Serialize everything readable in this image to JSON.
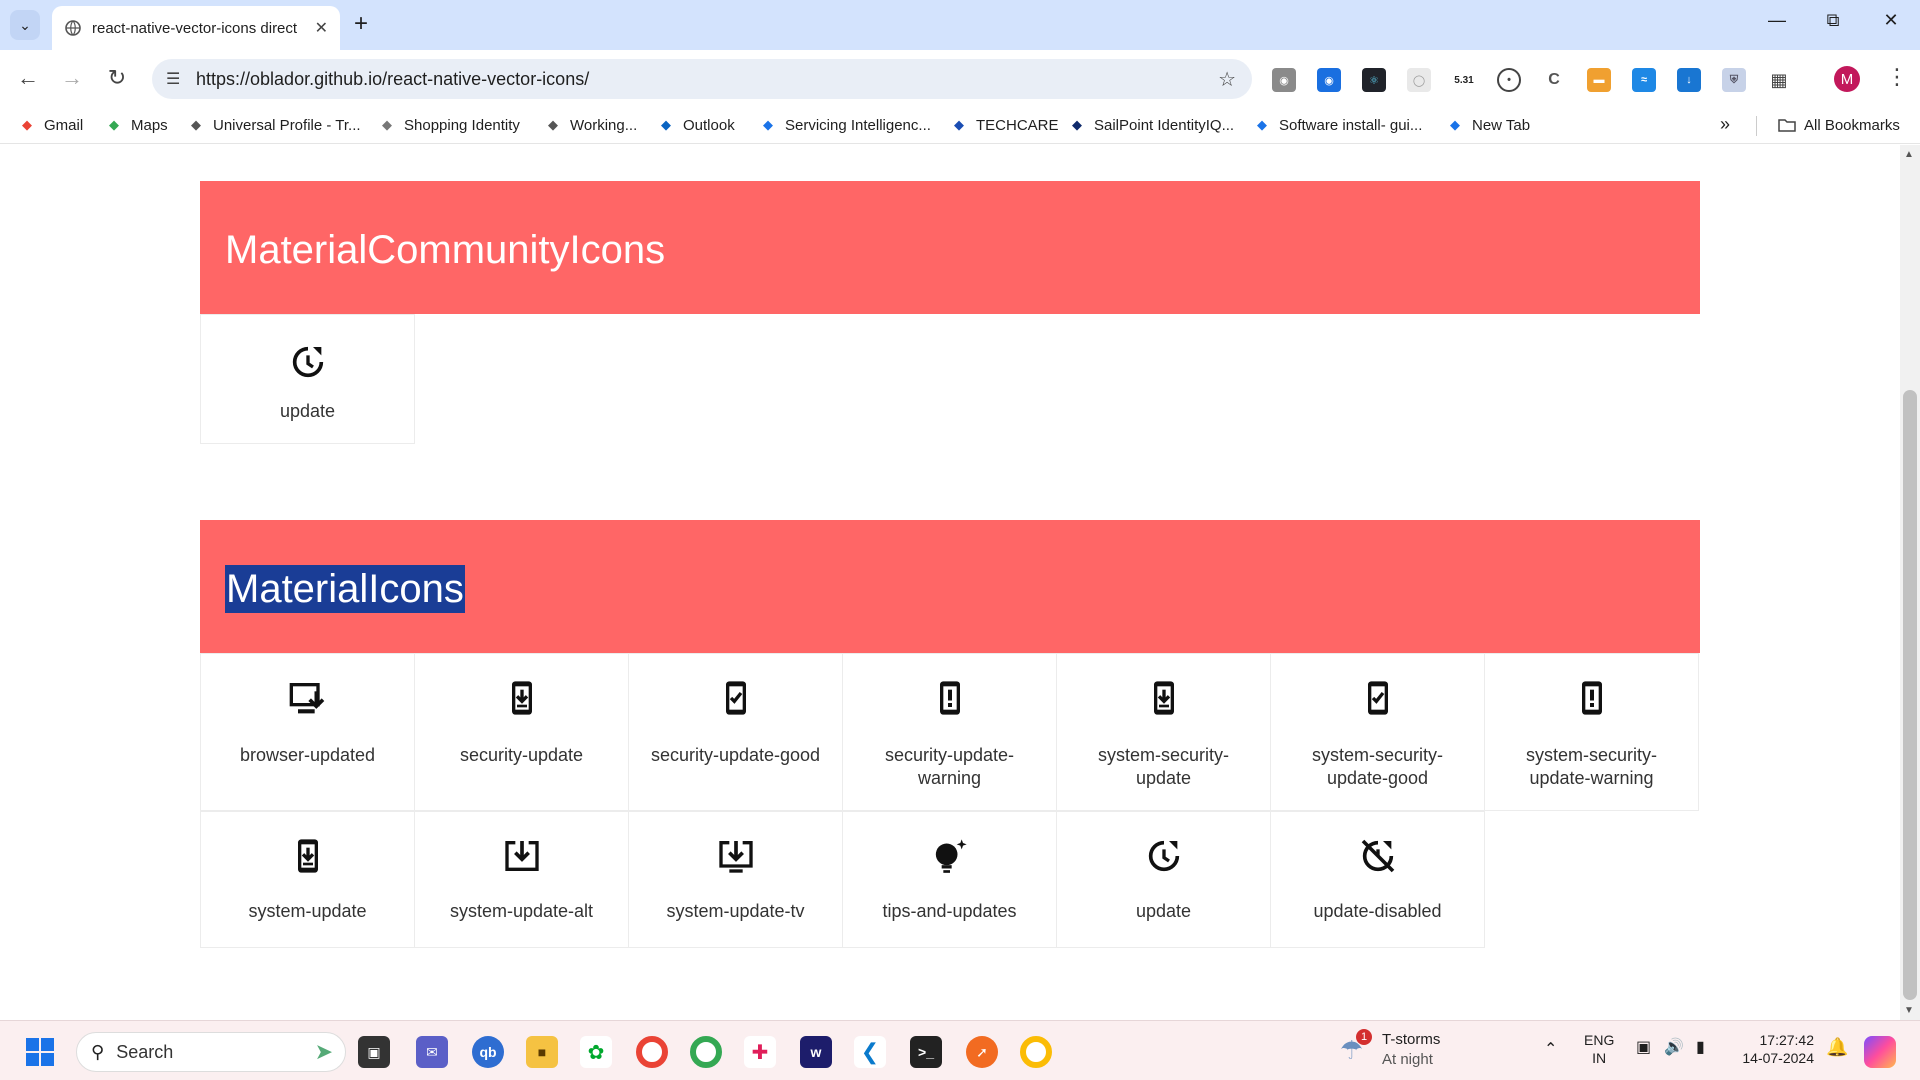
{
  "browser": {
    "tab_title": "react-native-vector-icons direct",
    "url": "https://oblador.github.io/react-native-vector-icons/",
    "profile_initial": "M",
    "extension_badge": "5.31",
    "bookmarks": [
      {
        "label": "Gmail",
        "icon": "gmail-icon",
        "color": "#ea4335"
      },
      {
        "label": "Maps",
        "icon": "maps-icon",
        "color": "#34a853"
      },
      {
        "label": "Universal Profile - Tr...",
        "icon": "globe-icon",
        "color": "#555555"
      },
      {
        "label": "Shopping Identity",
        "icon": "shopping-icon",
        "color": "#777777"
      },
      {
        "label": "Working...",
        "icon": "globe-icon",
        "color": "#555555"
      },
      {
        "label": "Outlook",
        "icon": "outlook-icon",
        "color": "#0a64c2"
      },
      {
        "label": "Servicing Intelligenc...",
        "icon": "servicing-icon",
        "color": "#1a73e8"
      },
      {
        "label": "TECHCARE",
        "icon": "techcare-icon",
        "color": "#1a4db3"
      },
      {
        "label": "SailPoint IdentityIQ...",
        "icon": "sailpoint-icon",
        "color": "#0f2a6b"
      },
      {
        "label": "Software install- gui...",
        "icon": "software-icon",
        "color": "#1a73e8"
      },
      {
        "label": "New Tab",
        "icon": "newtab-icon",
        "color": "#1a73e8"
      }
    ],
    "all_bookmarks": "All Bookmarks"
  },
  "sections": [
    {
      "title": "MaterialCommunityIcons",
      "icons": [
        {
          "name": "update",
          "glyph": "update"
        }
      ]
    },
    {
      "title": "MaterialIcons",
      "icons": [
        {
          "name": "browser-updated",
          "glyph": "browser-updated"
        },
        {
          "name": "security-update",
          "glyph": "phone-down"
        },
        {
          "name": "security-update-good",
          "glyph": "phone-check"
        },
        {
          "name": "security-update-warning",
          "glyph": "phone-warn"
        },
        {
          "name": "system-security-update",
          "glyph": "phone-down"
        },
        {
          "name": "system-security-update-good",
          "glyph": "phone-check"
        },
        {
          "name": "system-security-update-warning",
          "glyph": "phone-warn"
        },
        {
          "name": "system-update",
          "glyph": "phone-down"
        },
        {
          "name": "system-update-alt",
          "glyph": "box-down"
        },
        {
          "name": "system-update-tv",
          "glyph": "tv-down"
        },
        {
          "name": "tips-and-updates",
          "glyph": "bulb"
        },
        {
          "name": "update",
          "glyph": "update"
        },
        {
          "name": "update-disabled",
          "glyph": "update-disabled"
        }
      ]
    }
  ],
  "taskbar": {
    "search_placeholder": "Search",
    "weather_title": "T-storms",
    "weather_sub": "At night",
    "weather_badge": "1",
    "lang_top": "ENG",
    "lang_bottom": "IN",
    "time": "17:27:42",
    "date": "14-07-2024"
  },
  "colors": {
    "header_bg": "#ff6666",
    "selection": "#1a3d96"
  }
}
